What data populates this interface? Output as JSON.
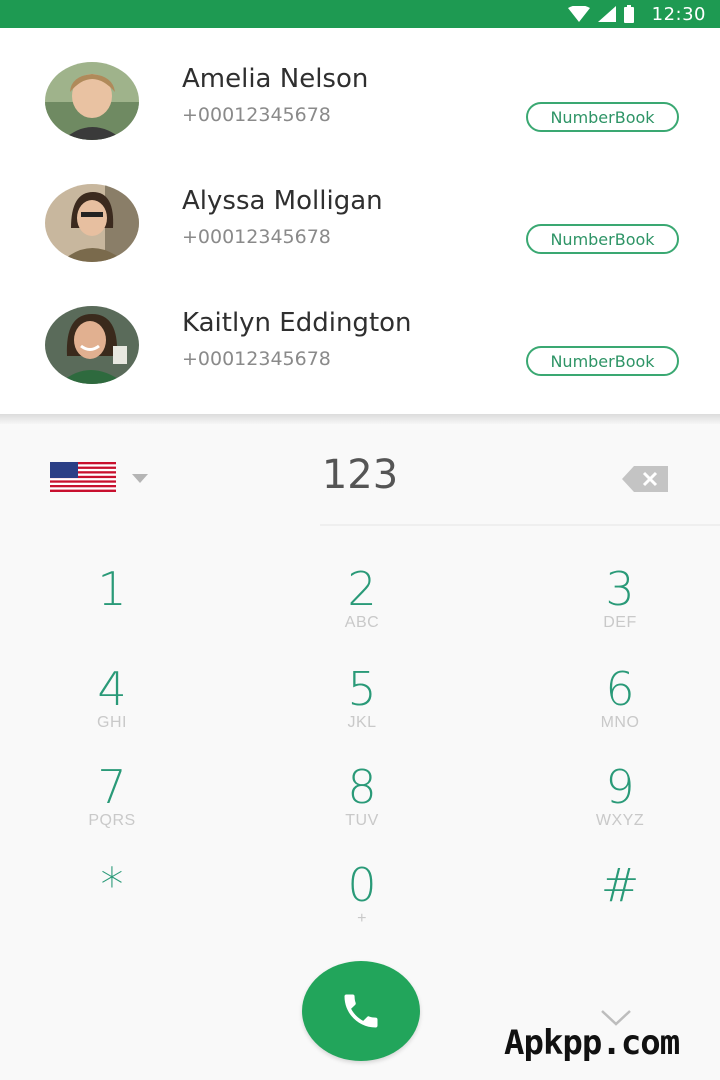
{
  "status_bar": {
    "time": "12:30",
    "icons": [
      "wifi-icon",
      "signal-icon",
      "battery-icon"
    ],
    "color": "#1e9a52"
  },
  "contacts": [
    {
      "name": "Amelia Nelson",
      "phone": "+00012345678",
      "badge": "NumberBook",
      "avatar": "avatar-amelia"
    },
    {
      "name": "Alyssa Molligan",
      "phone": "+00012345678",
      "badge": "NumberBook",
      "avatar": "avatar-alyssa"
    },
    {
      "name": "Kaitlyn Eddington",
      "phone": "+00012345678",
      "badge": "NumberBook",
      "avatar": "avatar-kaitlyn"
    }
  ],
  "dialer": {
    "country_flag": "us-flag-icon",
    "number": "123",
    "keys": [
      {
        "digit": "1",
        "letters": ""
      },
      {
        "digit": "2",
        "letters": "ABC"
      },
      {
        "digit": "3",
        "letters": "DEF"
      },
      {
        "digit": "4",
        "letters": "GHI"
      },
      {
        "digit": "5",
        "letters": "JKL"
      },
      {
        "digit": "6",
        "letters": "MNO"
      },
      {
        "digit": "7",
        "letters": "PQRS"
      },
      {
        "digit": "8",
        "letters": "TUV"
      },
      {
        "digit": "9",
        "letters": "WXYZ"
      },
      {
        "digit": "*",
        "letters": ""
      },
      {
        "digit": "0",
        "letters": "+"
      },
      {
        "digit": "#",
        "letters": ""
      }
    ],
    "accent_color": "#2a9a78",
    "call_button_color": "#22a55b"
  },
  "watermark": "Apkpp.com"
}
